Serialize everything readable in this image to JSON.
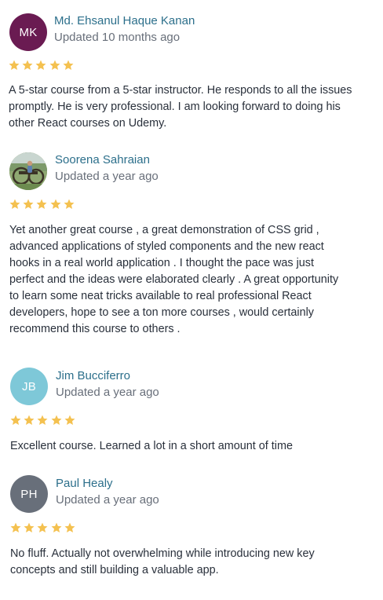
{
  "colors": {
    "star": "#f4c150",
    "name_link": "#2c6f8b",
    "meta_text": "#686f7a",
    "body_text": "#29303b"
  },
  "reviews": [
    {
      "initials": "MK",
      "avatar_color": "#6a1b52",
      "name": "Md. Ehsanul Haque Kanan",
      "updated": "Updated 10 months ago",
      "rating": 5,
      "lines": [
        "A 5-star course from a 5-star instructor. He responds to all the issues",
        "promptly. He is very professional. I am looking forward to doing his",
        "other React courses on Udemy."
      ]
    },
    {
      "avatar_icon": "user-photo-icon",
      "name": "Soorena Sahraian",
      "updated": "Updated a year ago",
      "rating": 5,
      "lines": [
        "Yet another great course , a great demonstration of CSS grid ,",
        "advanced applications of styled components and the new react",
        "hooks in a real world application . I thought the pace was just",
        "perfect and the ideas were elaborated clearly . A great opportunity",
        "to learn some neat tricks available to real professional React",
        "developers, hope to see a ton more courses , would certainly",
        "recommend this course to others ."
      ]
    },
    {
      "initials": "JB",
      "avatar_color": "#7ec8d8",
      "name": "Jim Bucciferro",
      "updated": "Updated a year ago",
      "rating": 5,
      "lines": [
        "Excellent course. Learned a lot in a short amount of time"
      ]
    },
    {
      "initials": "PH",
      "avatar_color": "#686f7a",
      "name": "Paul Healy",
      "updated": "Updated a year ago",
      "rating": 5,
      "lines": [
        "No fluff. Actually not overwhelming while introducing new key",
        "concepts and still building a valuable app."
      ]
    }
  ]
}
